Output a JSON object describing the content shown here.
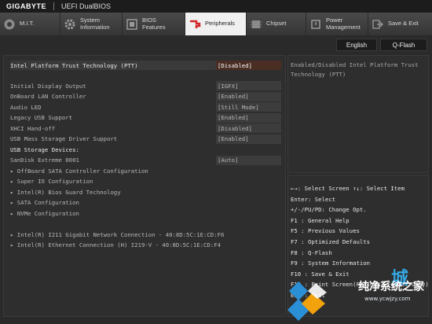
{
  "brand": {
    "name": "GIGABYTE",
    "product": "UEFI DualBIOS"
  },
  "tabs": [
    {
      "label": "M.I.T.",
      "icon": "mit-icon"
    },
    {
      "label": "System Information",
      "icon": "system-info-icon"
    },
    {
      "label": "BIOS Features",
      "icon": "bios-features-icon"
    },
    {
      "label": "Peripherals",
      "icon": "peripherals-icon",
      "active": true
    },
    {
      "label": "Chipset",
      "icon": "chipset-icon"
    },
    {
      "label": "Power Management",
      "icon": "power-icon"
    },
    {
      "label": "Save & Exit",
      "icon": "exit-icon"
    }
  ],
  "toolbar": {
    "language": "English",
    "qflash": "Q-Flash"
  },
  "settings": {
    "ptt": {
      "label": "Intel Platform Trust Technology (PTT)",
      "value": "[Disabled]"
    },
    "initial_display": {
      "label": "Initial Display Output",
      "value": "[IGFX]"
    },
    "onboard_lan": {
      "label": "OnBoard LAN Controller",
      "value": "[Enabled]"
    },
    "audio_led": {
      "label": "Audio LED",
      "value": "[Still Mode]"
    },
    "legacy_usb": {
      "label": "Legacy USB Support",
      "value": "[Enabled]"
    },
    "xhci_handoff": {
      "label": "XHCI Hand-off",
      "value": "[Disabled]"
    },
    "usb_mass_storage": {
      "label": "USB Mass Storage Driver Support",
      "value": "[Enabled]"
    },
    "usb_storage_header": "USB Storage Devices:",
    "sandisk": {
      "label": "SanDisk Extreme 0001",
      "value": "[Auto]"
    }
  },
  "submenus": [
    "OffBoard SATA Controller Configuration",
    "Super IO Configuration",
    "Intel(R) Bios Guard Technology",
    "SATA Configuration",
    "NVMe Configuration"
  ],
  "network": [
    "Intel(R) I211 Gigabit  Network Connection - 40:8D:5C:1E:CD:F6",
    "Intel(R) Ethernet Connection (H) I219-V - 40:8D:5C:1E:CD:F4"
  ],
  "help_text": "Enabled/Disabled Intel Platform Trust Technology (PTT)",
  "keys": [
    "←→: Select Screen  ↑↓: Select Item",
    "Enter: Select",
    "+/-/PU/PD: Change Opt.",
    "F1  : General Help",
    "F5  : Previous Values",
    "F7  : Optimized Defaults",
    "F8  : Q-Flash",
    "F9  : System Information",
    "F10 : Save & Exit",
    "F12 : Print Screen(FAT16/32 Format Only)",
    "ESC : Exit"
  ],
  "watermark": {
    "title": "纯净系统之家",
    "char": "城",
    "url": "www.ycwjzy.com"
  },
  "colors": {
    "selection": "#4a2e24",
    "watermark_blue": "#34a6e0"
  }
}
